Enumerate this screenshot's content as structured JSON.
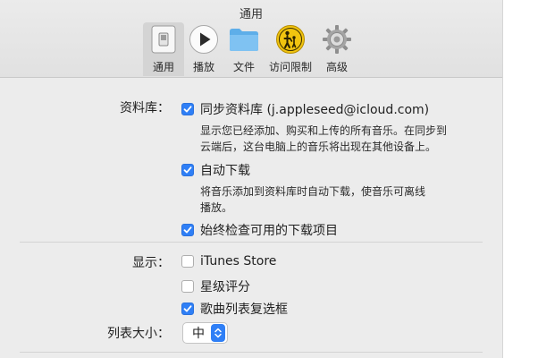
{
  "window": {
    "title": "通用"
  },
  "toolbar": {
    "tabs": [
      {
        "label": "通用",
        "icon": "general-switch-icon",
        "selected": true
      },
      {
        "label": "播放",
        "icon": "play-icon",
        "selected": false
      },
      {
        "label": "文件",
        "icon": "folder-icon",
        "selected": false
      },
      {
        "label": "访问限制",
        "icon": "parental-controls-icon",
        "selected": false
      },
      {
        "label": "高级",
        "icon": "gear-icon",
        "selected": false
      }
    ]
  },
  "library": {
    "label": "资料库：",
    "sync": {
      "label": "同步资料库 (j.appleseed@icloud.com)",
      "checked": true,
      "desc_line1": "显示您已经添加、购买和上传的所有音乐。在同步到",
      "desc_line2": "云端后，这台电脑上的音乐将出现在其他设备上。"
    },
    "auto_download": {
      "label": "自动下载",
      "checked": true,
      "desc_line1": "将音乐添加到资料库时自动下载，使音乐可离线",
      "desc_line2": "播放。"
    },
    "always_check": {
      "label": "始终检查可用的下载项目",
      "checked": true
    }
  },
  "show": {
    "label": "显示：",
    "itunes_store": {
      "label": "iTunes Store",
      "checked": false
    },
    "star_rating": {
      "label": "星级评分",
      "checked": false
    },
    "song_list_checkboxes": {
      "label": "歌曲列表复选框",
      "checked": true
    }
  },
  "list_size": {
    "label": "列表大小：",
    "value": "中"
  },
  "colors": {
    "accent": "#2f7ff6",
    "window_bg": "#ececec"
  }
}
